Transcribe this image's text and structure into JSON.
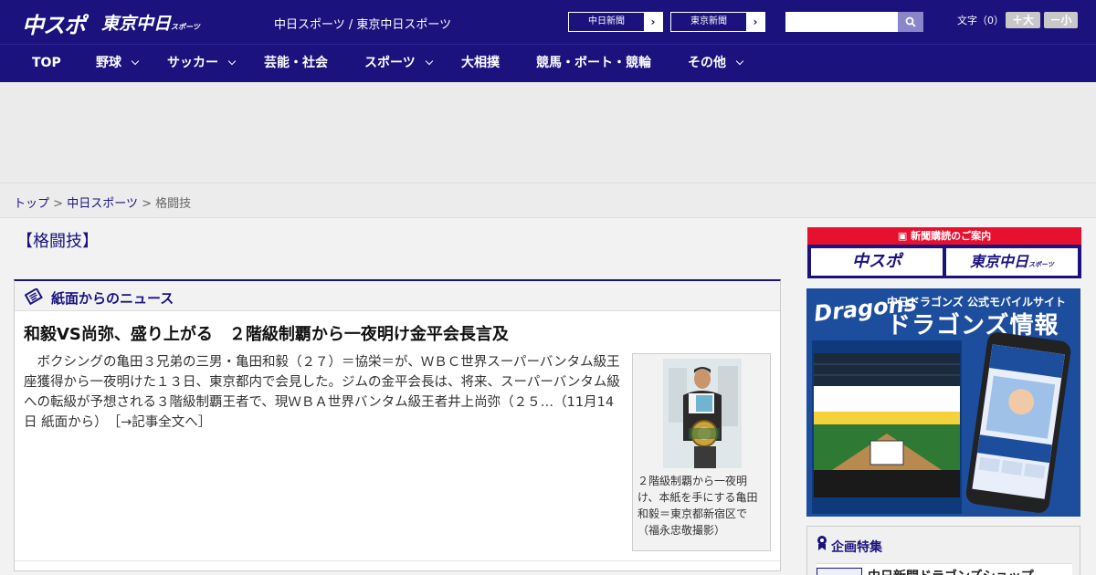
{
  "header": {
    "logo_chuspo": "中スポ",
    "logo_tokyo": "東京中日",
    "logo_tokyo_small": "スポーツ",
    "site_name": "中日スポーツ / 東京中日スポーツ",
    "links": [
      {
        "label": "中日新聞"
      },
      {
        "label": "東京新聞"
      }
    ],
    "search_placeholder": "",
    "font_size_label": "文字（0）",
    "font_up": "＋大",
    "font_down": "－小"
  },
  "nav": {
    "items": [
      {
        "label": "TOP",
        "dropdown": false
      },
      {
        "label": "野球",
        "dropdown": true
      },
      {
        "label": "サッカー",
        "dropdown": true
      },
      {
        "label": "芸能・社会",
        "dropdown": false
      },
      {
        "label": "スポーツ",
        "dropdown": true
      },
      {
        "label": "大相撲",
        "dropdown": false
      },
      {
        "label": "競馬・ボート・競輪",
        "dropdown": false
      },
      {
        "label": "その他",
        "dropdown": true
      }
    ]
  },
  "breadcrumb": {
    "items": [
      "トップ",
      "中日スポーツ",
      "格闘技"
    ],
    "separator": ">"
  },
  "page": {
    "title": "【格闘技】"
  },
  "news": {
    "section_label": "紙面からのニュース",
    "headline": "和毅VS尚弥、盛り上がる　２階級制覇から一夜明け金平会長言及",
    "body": "ボクシングの亀田３兄弟の三男・亀田和毅（２７）＝協栄＝が、ＷＢＣ世界スーパーバンタム級王座獲得から一夜明けた１３日、東京都内で会見した。ジムの金平会長は、将来、スーパーバンタム級への転級が予想される３階級制覇王者で、現ＷＢＡ世界バンタム級王者井上尚弥（２５…（11月14日 紙面から）",
    "more_link": "［→記事全文へ］",
    "photo_caption": "２階級制覇から一夜明け、本紙を手にする亀田和毅＝東京都新宿区で（福永忠敬撮影）"
  },
  "sidebar": {
    "subscription": {
      "title": "新聞購読のご案内",
      "tiles": [
        "中スポ",
        "東京中日"
      ],
      "tile_small": "スポーツ"
    },
    "dragons": {
      "logo": "Dragons",
      "subtitle": "中日ドラゴンズ 公式モバイルサイト",
      "title": "ドラゴンズ情報"
    },
    "feature": {
      "head": "企画特集",
      "item": "中日新聞ドラゴンズショップ"
    }
  },
  "colors": {
    "brand": "#1b127e",
    "accent_red": "#e8102f",
    "dragons_blue": "#1d4e9e"
  }
}
